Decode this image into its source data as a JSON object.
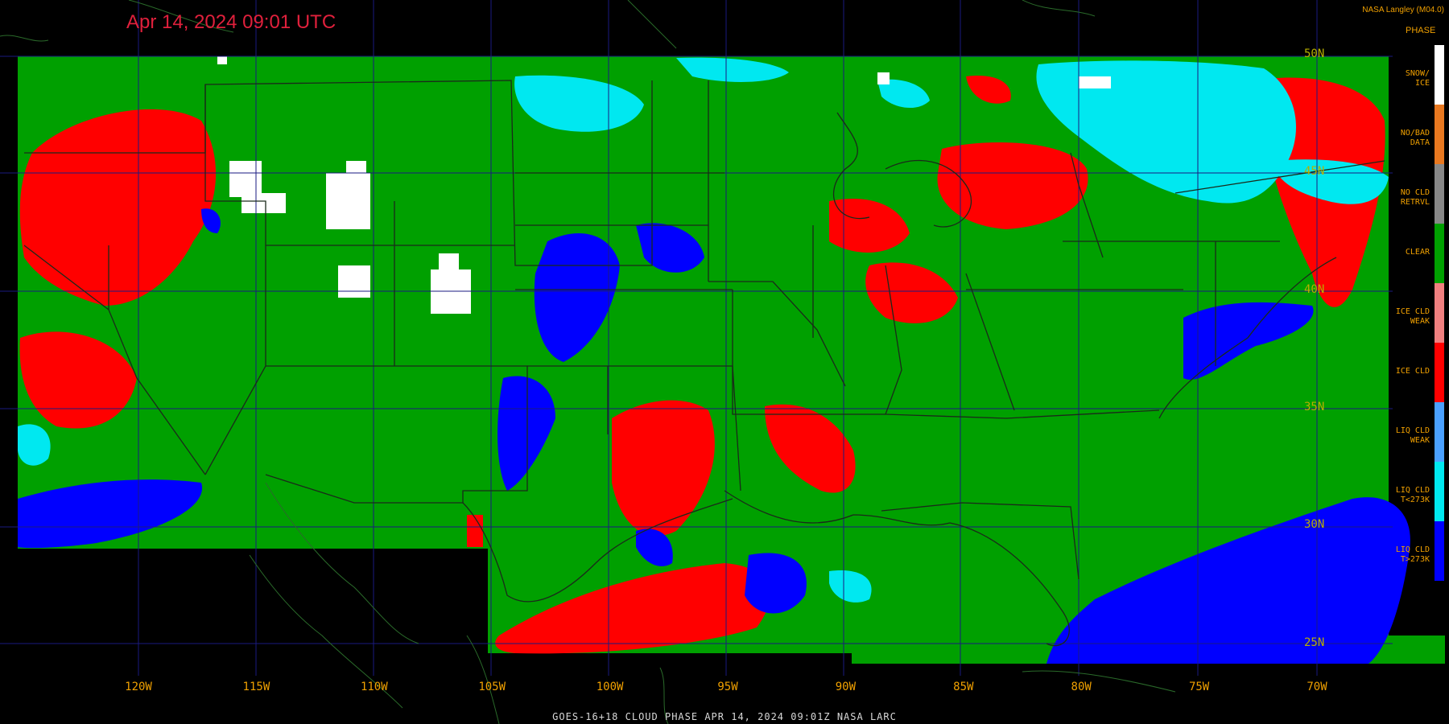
{
  "header": {
    "timestamp": "Apr 14, 2024 09:01 UTC",
    "credit": "NASA Langley (M04.0)"
  },
  "legend": {
    "title": "PHASE",
    "items": [
      {
        "line1": "SNOW/",
        "line2": "ICE",
        "color": "#ffffff"
      },
      {
        "line1": "NO/BAD",
        "line2": "DATA",
        "color": "#e87820"
      },
      {
        "line1": "NO CLD",
        "line2": "RETRVL",
        "color": "#888888"
      },
      {
        "line1": "CLEAR",
        "line2": "",
        "color": "#00a000"
      },
      {
        "line1": "ICE CLD",
        "line2": "WEAK",
        "color": "#f08080"
      },
      {
        "line1": "ICE CLD",
        "line2": "",
        "color": "#ff0000"
      },
      {
        "line1": "LIQ CLD",
        "line2": "WEAK",
        "color": "#4aa0ff"
      },
      {
        "line1": "LIQ CLD",
        "line2": "T<273K",
        "color": "#00e8f0"
      },
      {
        "line1": "LIQ CLD",
        "line2": "T>273K",
        "color": "#0000ff"
      }
    ]
  },
  "longitudes": [
    "120W",
    "115W",
    "110W",
    "105W",
    "100W",
    "95W",
    "90W",
    "85W",
    "80W",
    "75W",
    "70W"
  ],
  "latitudes": [
    "50N",
    "45N",
    "40N",
    "35N",
    "30N",
    "25N"
  ],
  "footer": "GOES-16+18  CLOUD PHASE  APR 14, 2024 09:01Z  NASA LARC"
}
